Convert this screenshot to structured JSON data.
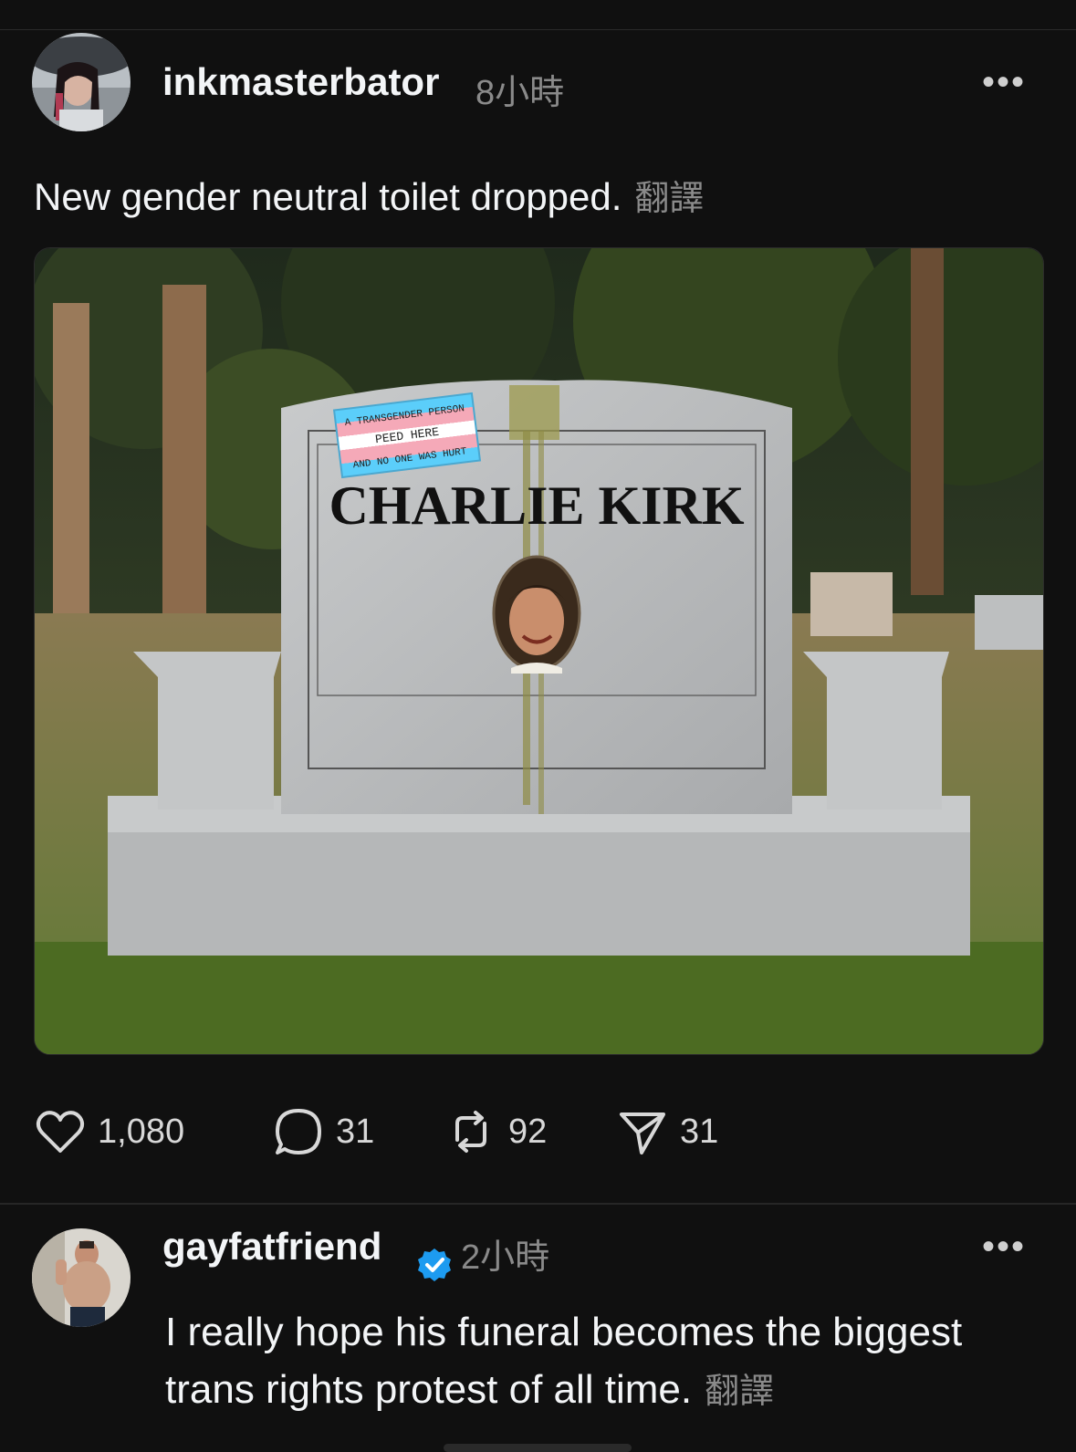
{
  "post": {
    "username": "inkmasterbator",
    "time": "8小時",
    "text": "New gender neutral toilet dropped.",
    "translate": "翻譯",
    "image": {
      "sticker_line1": "A TRANSGENDER PERSON",
      "sticker_line2": "PEED HERE",
      "sticker_line3": "AND NO ONE WAS HURT",
      "headstone_name": "CHARLIE KIRK"
    },
    "likes": "1,080",
    "comments": "31",
    "reposts": "92",
    "shares": "31"
  },
  "reply": {
    "username": "gayfatfriend",
    "time": "2小時",
    "text": "I really hope his funeral becomes the biggest trans rights protest of all time.",
    "translate": "翻譯"
  },
  "colors": {
    "background": "#101010",
    "text": "#f3f5f7",
    "muted": "#8a8a8a",
    "verified": "#1d9bf0"
  }
}
